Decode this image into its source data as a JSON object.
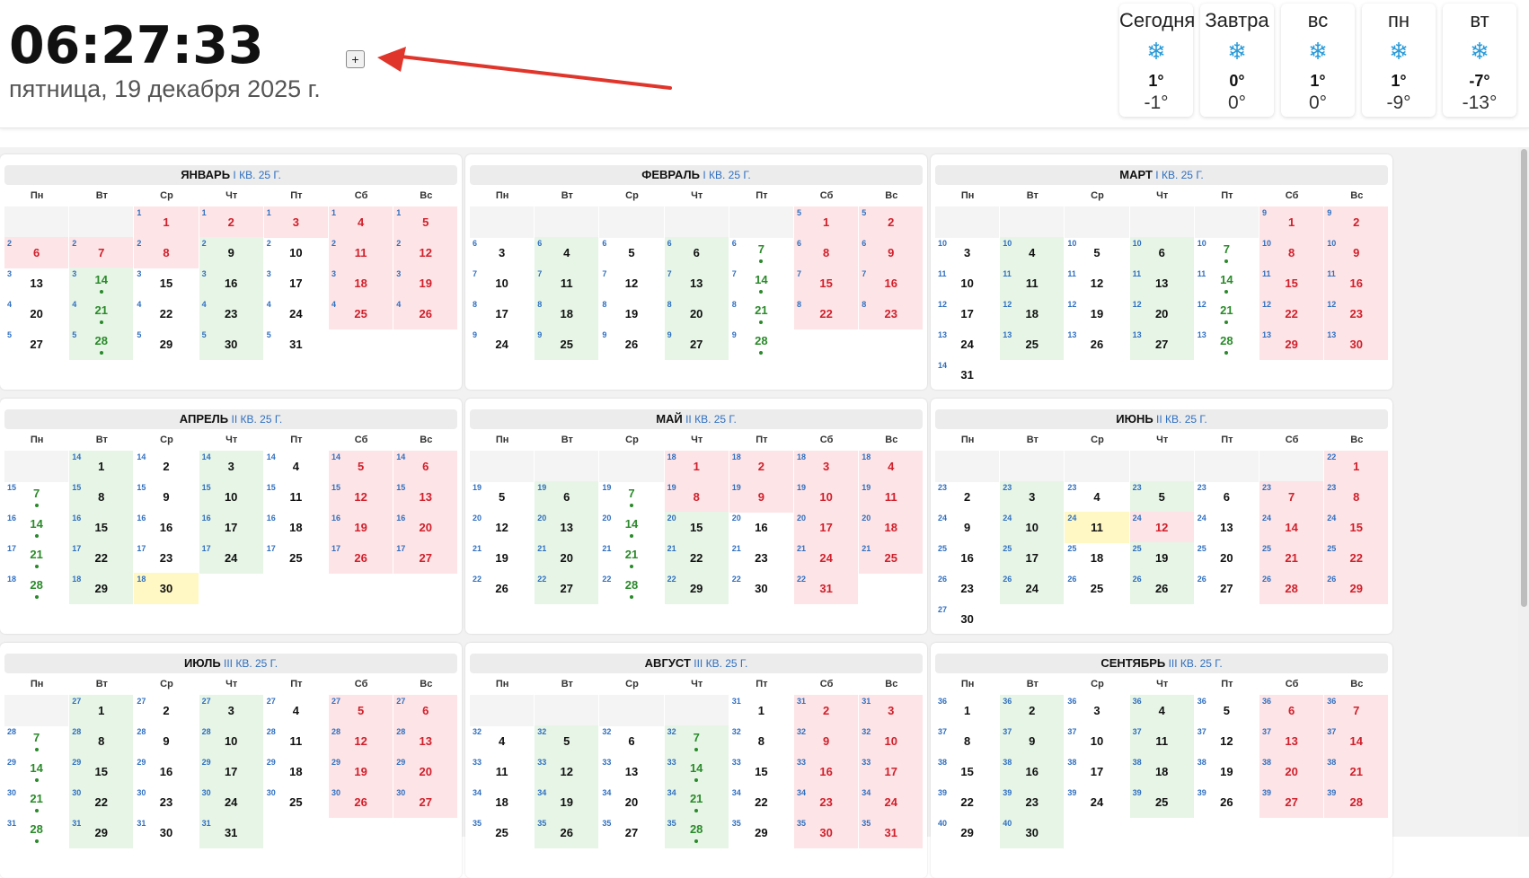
{
  "header": {
    "time": "06:27:33",
    "date": "пятница, 19 декабря 2025 г.",
    "add_button": "+"
  },
  "weather": [
    {
      "day": "Сегодня",
      "icon": "snowflake-icon",
      "max": "1°",
      "min": "-1°"
    },
    {
      "day": "Завтра",
      "icon": "snowflake-icon",
      "max": "0°",
      "min": "0°"
    },
    {
      "day": "вс",
      "icon": "snowflake-icon",
      "max": "1°",
      "min": "0°"
    },
    {
      "day": "пн",
      "icon": "snowflake-icon",
      "max": "1°",
      "min": "-9°"
    },
    {
      "day": "вт",
      "icon": "snowflake-icon",
      "max": "-7°",
      "min": "-13°"
    }
  ],
  "weekdays": [
    "Пн",
    "Вт",
    "Ср",
    "Чт",
    "Пт",
    "Сб",
    "Вс"
  ],
  "months": [
    {
      "name": "ЯНВАРЬ",
      "quarter": "I КВ. 25 Г."
    },
    {
      "name": "ФЕВРАЛЬ",
      "quarter": "I КВ. 25 Г."
    },
    {
      "name": "МАРТ",
      "quarter": "I КВ. 25 Г."
    },
    {
      "name": "АПРЕЛЬ",
      "quarter": "II КВ. 25 Г."
    },
    {
      "name": "МАЙ",
      "quarter": "II КВ. 25 Г."
    },
    {
      "name": "ИЮНЬ",
      "quarter": "II КВ. 25 Г."
    },
    {
      "name": "ИЮЛЬ",
      "quarter": "III КВ. 25 Г."
    },
    {
      "name": "АВГУСТ",
      "quarter": "III КВ. 25 Г."
    },
    {
      "name": "СЕНТЯБРЬ",
      "quarter": "III КВ. 25 Г."
    }
  ],
  "colors": {
    "holiday": "#fde4e6",
    "workday_green": "#e6f5e6",
    "today": "#fff8c4",
    "accent": "#2f6fc0",
    "moon": "#2a8a2a"
  }
}
